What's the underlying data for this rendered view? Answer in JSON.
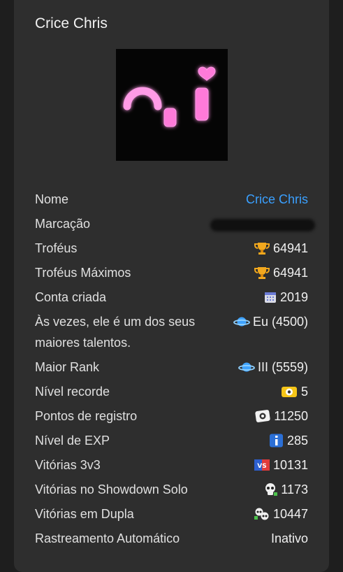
{
  "profile": {
    "title": "Crice Chris",
    "avatar_icon": "pink-neon-face-icon"
  },
  "rows": [
    {
      "label": "Nome",
      "value": "Crice Chris",
      "icon": "",
      "type": "link"
    },
    {
      "label": "Marcação",
      "value": "",
      "icon": "",
      "type": "redacted"
    },
    {
      "label": "Troféus",
      "value": "64941",
      "icon": "trophy-icon"
    },
    {
      "label": "Troféus Máximos",
      "value": "64941",
      "icon": "trophy-icon"
    },
    {
      "label": "Conta criada",
      "value": "2019",
      "icon": "calendar-icon"
    },
    {
      "label": "Às vezes, ele é um dos seus maiores talentos.",
      "value": "Eu (4500)",
      "icon": "planet-icon"
    },
    {
      "label": "Maior Rank",
      "value": "III (5559)",
      "icon": "planet-icon"
    },
    {
      "label": "Nível recorde",
      "value": "5",
      "icon": "record-level-icon"
    },
    {
      "label": "Pontos de registro",
      "value": "11250",
      "icon": "record-points-icon"
    },
    {
      "label": "Nível de EXP",
      "value": "285",
      "icon": "exp-info-icon"
    },
    {
      "label": "Vitórias 3v3",
      "value": "10131",
      "icon": "versus-icon"
    },
    {
      "label": "Vitórias no Showdown Solo",
      "value": "1173",
      "icon": "skull-icon"
    },
    {
      "label": "Vitórias em Dupla",
      "value": "10447",
      "icon": "duo-skull-icon"
    },
    {
      "label": "Rastreamento Automático",
      "value": "Inativo",
      "icon": ""
    }
  ],
  "colors": {
    "accent": "#3aa0ff",
    "card_bg": "#2e2e2e",
    "avatar_glow": "#ff7ad9"
  }
}
